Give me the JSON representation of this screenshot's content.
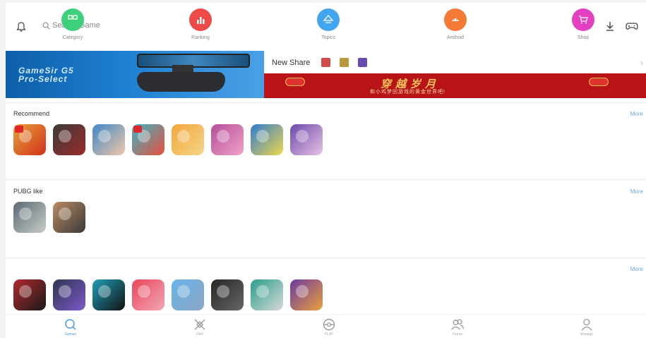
{
  "header": {
    "search_placeholder": "Search Game",
    "categories": [
      {
        "label": "Category",
        "icon": "grid-icon",
        "color": "#3dd07c"
      },
      {
        "label": "Ranking",
        "icon": "bar-chart-icon",
        "color": "#ee4a4a"
      },
      {
        "label": "Topics",
        "icon": "topics-icon",
        "color": "#42a5ef"
      },
      {
        "label": "Android",
        "icon": "android-icon",
        "color": "#f47a36"
      },
      {
        "label": "Shop",
        "icon": "cart-icon",
        "color": "#e33fbf"
      }
    ]
  },
  "banner": {
    "left_text_line1": "GameSir G5",
    "left_text_line2": "Pro-Select",
    "right_label": "New Share",
    "right_title": "穿越岁月",
    "right_subtitle": "和小鸡梦回游戏的黄金世界吧!"
  },
  "sections": [
    {
      "title": "Recommend",
      "more": "More",
      "apps": [
        {
          "name": "dragon-ball-game",
          "color": "#e8a23a",
          "color2": "#d0301a",
          "tag": true
        },
        {
          "name": "dark-action-game",
          "color": "#3a3a3a",
          "color2": "#9b2b2b",
          "tag": false
        },
        {
          "name": "anime-soccer-game",
          "color": "#3f87c8",
          "color2": "#f2c7a8",
          "tag": false
        },
        {
          "name": "cartoon-game",
          "color": "#3ab5c4",
          "color2": "#e94e3c",
          "tag": true
        },
        {
          "name": "naruto-game",
          "color": "#f2a63a",
          "color2": "#f5d58a",
          "tag": false
        },
        {
          "name": "pink-anime-game",
          "color": "#b34e9a",
          "color2": "#f2a2c8",
          "tag": false
        },
        {
          "name": "saiyan-game",
          "color": "#2f7bd0",
          "color2": "#f0d84a",
          "tag": false
        },
        {
          "name": "purple-anime-game",
          "color": "#6b4aa8",
          "color2": "#e9c2e6",
          "tag": false
        }
      ]
    },
    {
      "title": "PUBG like",
      "more": "More",
      "apps": [
        {
          "name": "pubg-mobile",
          "color": "#5b6a74",
          "color2": "#c7ccc8",
          "tag": false
        },
        {
          "name": "survival-game",
          "color": "#b98a62",
          "color2": "#3a3a3a",
          "tag": false
        }
      ]
    },
    {
      "title": "",
      "more": "More",
      "apps": [
        {
          "name": "red-card-game",
          "color": "#b2282d",
          "color2": "#1a1a1a",
          "tag": false
        },
        {
          "name": "racing-game",
          "color": "#2e3552",
          "color2": "#7d58c8",
          "tag": false
        },
        {
          "name": "shadow-game",
          "color": "#1f9fb8",
          "color2": "#111111",
          "tag": false
        },
        {
          "name": "block-game",
          "color": "#e7455a",
          "color2": "#f3a7b4",
          "tag": false
        },
        {
          "name": "pixel-sword-game",
          "color": "#67b3e8",
          "color2": "#8aa6c5",
          "tag": false
        },
        {
          "name": "horror-game",
          "color": "#262626",
          "color2": "#676767",
          "tag": false
        },
        {
          "name": "retro-computer-game",
          "color": "#2a9e8a",
          "color2": "#d8d8d8",
          "tag": false
        },
        {
          "name": "pokemon-style-game",
          "color": "#6c3aa0",
          "color2": "#e9a03a",
          "tag": false
        }
      ]
    }
  ],
  "bottom_nav": [
    {
      "label": "Games",
      "icon": "search-icon",
      "active": true
    },
    {
      "label": "FAN",
      "icon": "fan-icon",
      "active": false
    },
    {
      "label": "PLAY",
      "icon": "pokeball-icon",
      "active": false
    },
    {
      "label": "Forum",
      "icon": "people-icon",
      "active": false
    },
    {
      "label": "Manage",
      "icon": "user-icon",
      "active": false
    }
  ]
}
